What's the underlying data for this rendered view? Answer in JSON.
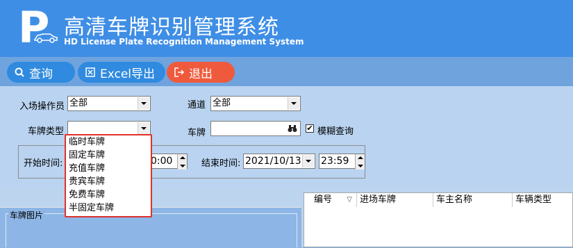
{
  "header": {
    "logo_letter": "P",
    "title_cn": "高清车牌识别管理系统",
    "title_en": "HD License Plate Recognition Management System"
  },
  "toolbar": {
    "query_label": "查询",
    "excel_label": "Excel导出",
    "exit_label": "退出",
    "colors": {
      "blue": "#2f8ae0",
      "red": "#f05a3c"
    }
  },
  "filters": {
    "operator_label": "入场操作员",
    "operator_value": "全部",
    "channel_label": "通道",
    "channel_value": "全部",
    "plate_type_label": "车牌类型",
    "plate_type_value": "",
    "plate_label": "车牌",
    "plate_value": "",
    "fuzzy_label": "模糊查询",
    "fuzzy_checked": "✔",
    "start_label": "开始时间:",
    "start_time": "0:00",
    "end_label": "结束时间:",
    "end_date": "2021/10/13",
    "end_time": "23:59"
  },
  "dropdown": {
    "items": [
      "临时车牌",
      "固定车牌",
      "充值车牌",
      "贵宾车牌",
      "免费车牌",
      "半固定车牌"
    ]
  },
  "image_panel": {
    "label": "车牌图片"
  },
  "grid": {
    "columns": [
      "编号",
      "进场车牌",
      "车主名称",
      "车辆类型"
    ]
  }
}
